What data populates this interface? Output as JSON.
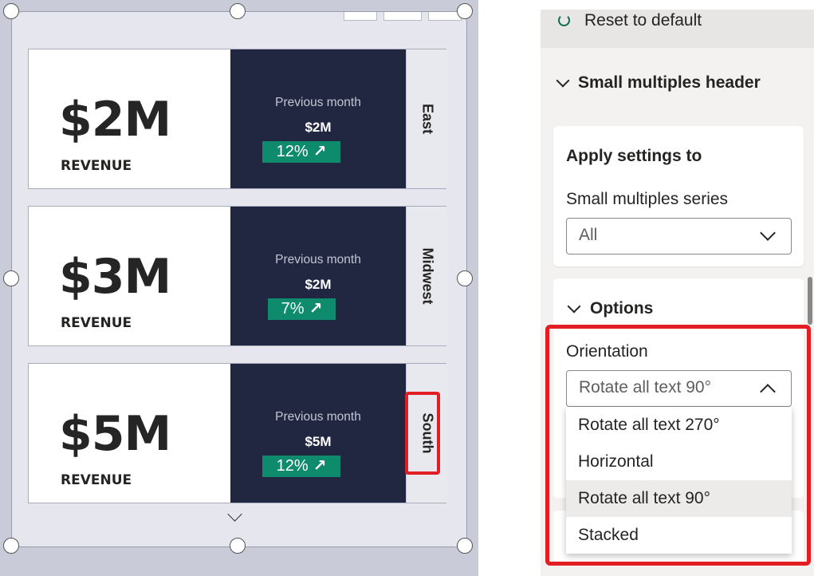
{
  "visual": {
    "cards": [
      {
        "value": "$2M",
        "label": "REVENUE",
        "prev_label": "Previous month",
        "prev_value": "$2M",
        "change": "12%",
        "change_icon": "arrow-up-right-icon",
        "region": "East"
      },
      {
        "value": "$3M",
        "label": "REVENUE",
        "prev_label": "Previous month",
        "prev_value": "$2M",
        "change": "7%",
        "change_icon": "arrow-up-right-icon",
        "region": "Midwest"
      },
      {
        "value": "$5M",
        "label": "REVENUE",
        "prev_label": "Previous month",
        "prev_value": "$5M",
        "change": "12%",
        "change_icon": "arrow-up-right-icon",
        "region": "South"
      }
    ],
    "colors": {
      "card_dark": "#222741",
      "positive": "#0e8a6c",
      "highlight": "#e21d24"
    }
  },
  "format_pane": {
    "reset_label": "Reset to default",
    "small_multiples_header": "Small multiples header",
    "apply_settings_to": "Apply settings to",
    "series_label": "Small multiples series",
    "series_value": "All",
    "options_label": "Options",
    "orientation_label": "Orientation",
    "orientation_value": "Rotate all text 90°",
    "orientation_options": [
      "Rotate all text 270°",
      "Horizontal",
      "Rotate all text 90°",
      "Stacked"
    ],
    "selected_option": "Rotate all text 90°"
  }
}
